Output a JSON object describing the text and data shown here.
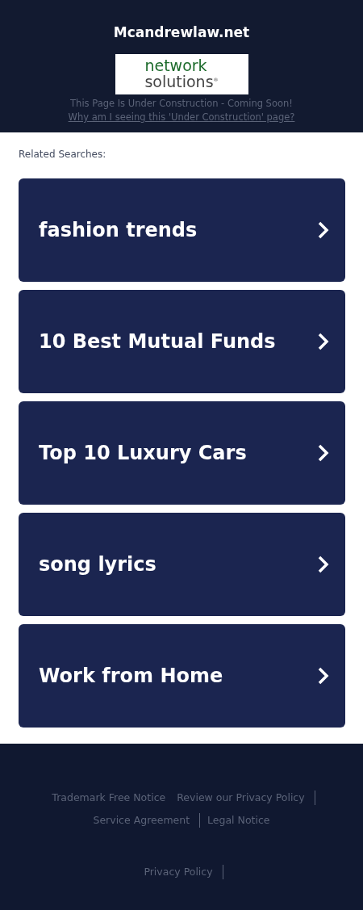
{
  "header": {
    "domain": "Mcandrewlaw.net",
    "logo": {
      "line_1": "network",
      "line_2": "solutions",
      "mark": "®"
    },
    "notice": "This Page Is Under Construction - Coming Soon!",
    "notice_link": "Why am I seeing this 'Under Construction' page?"
  },
  "related": {
    "title": "Related Searches:",
    "items": [
      {
        "label": "fashion trends"
      },
      {
        "label": "10 Best Mutual Funds"
      },
      {
        "label": "Top 10 Luxury Cars"
      },
      {
        "label": "song lyrics"
      },
      {
        "label": "Work from Home"
      }
    ]
  },
  "footer": {
    "links": [
      {
        "label": "Trademark Free Notice",
        "divider": false
      },
      {
        "label": "Review our Privacy Policy",
        "divider": true
      },
      {
        "label": "Service Agreement",
        "divider": true
      },
      {
        "label": "Legal Notice",
        "divider": false
      }
    ],
    "bottom_links": [
      {
        "label": "Privacy Policy",
        "divider": true
      }
    ]
  }
}
